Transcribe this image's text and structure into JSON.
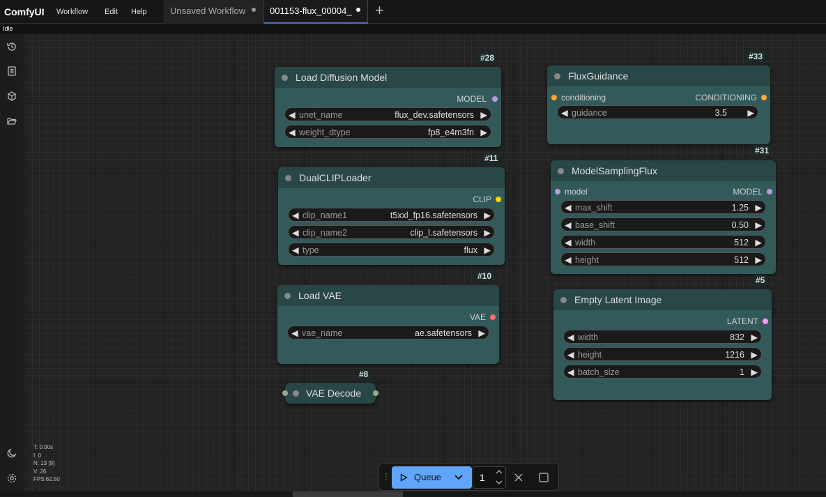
{
  "app": {
    "name": "ComfyUI",
    "menu": [
      "Workflow",
      "Edit",
      "Help"
    ],
    "tabs": [
      {
        "label": "Unsaved Workflow"
      },
      {
        "label": "001153-flux_00004_"
      }
    ],
    "status": "Idle"
  },
  "nodes": {
    "load_diffusion": {
      "id": "#28",
      "title": "Load Diffusion Model",
      "output": "MODEL",
      "widgets": [
        {
          "name": "unet_name",
          "value": "flux_dev.safetensors"
        },
        {
          "name": "weight_dtype",
          "value": "fp8_e4m3fn"
        }
      ]
    },
    "dual_clip": {
      "id": "#11",
      "title": "DualCLIPLoader",
      "output": "CLIP",
      "widgets": [
        {
          "name": "clip_name1",
          "value": "t5xxl_fp16.safetensors"
        },
        {
          "name": "clip_name2",
          "value": "clip_l.safetensors"
        },
        {
          "name": "type",
          "value": "flux"
        }
      ]
    },
    "load_vae": {
      "id": "#10",
      "title": "Load VAE",
      "output": "VAE",
      "widgets": [
        {
          "name": "vae_name",
          "value": "ae.safetensors"
        }
      ]
    },
    "vae_decode": {
      "id": "#8",
      "title": "VAE Decode"
    },
    "flux_guidance": {
      "id": "#33",
      "title": "FluxGuidance",
      "input": "conditioning",
      "output": "CONDITIONING",
      "widgets": [
        {
          "name": "guidance",
          "value": "3.5"
        }
      ]
    },
    "model_sampling": {
      "id": "#31",
      "title": "ModelSamplingFlux",
      "input": "model",
      "output": "MODEL",
      "widgets": [
        {
          "name": "max_shift",
          "value": "1.25"
        },
        {
          "name": "base_shift",
          "value": "0.50"
        },
        {
          "name": "width",
          "value": "512"
        },
        {
          "name": "height",
          "value": "512"
        }
      ]
    },
    "empty_latent": {
      "id": "#5",
      "title": "Empty Latent Image",
      "output": "LATENT",
      "widgets": [
        {
          "name": "width",
          "value": "832"
        },
        {
          "name": "height",
          "value": "1216"
        },
        {
          "name": "batch_size",
          "value": "1"
        }
      ]
    }
  },
  "stats": [
    "T: 0.00s",
    "I: 0",
    "N: 13 [9]",
    "V: 26",
    "FPS:62.50"
  ],
  "queue": {
    "label": "Queue",
    "count": "1"
  },
  "colors": {
    "node_body": "#335a5a",
    "node_header": "#2a4748",
    "queue_button": "#60a5fa",
    "model_socket": "#b39ddb",
    "clip_socket": "#ffd500",
    "vae_socket": "#ff6e6e",
    "conditioning_socket": "#ffa931",
    "latent_socket": "#ff9cf9"
  }
}
